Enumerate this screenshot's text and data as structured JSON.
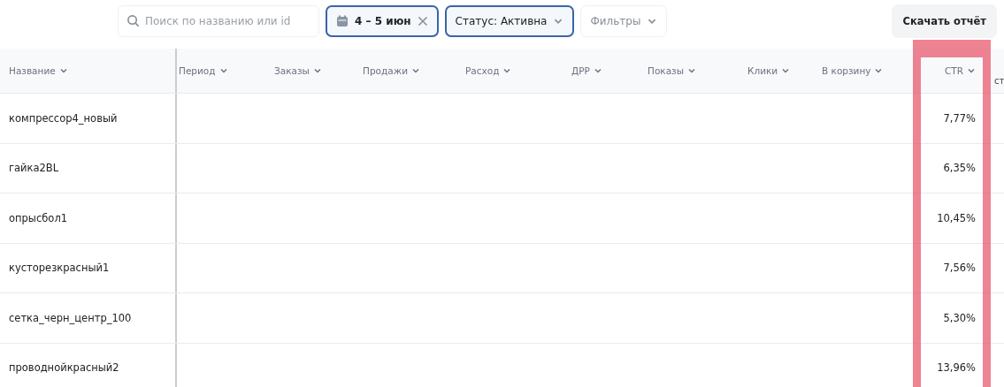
{
  "toolbar": {
    "search": {
      "placeholder": "Поиск по названию или id"
    },
    "date_filter": {
      "label": "4 – 5 июн",
      "active": true
    },
    "status_filter": {
      "label": "Статус: Активна",
      "active": true
    },
    "filters": {
      "label": "Фильтры",
      "active": false
    },
    "download_button": "Скачать отчёт"
  },
  "table": {
    "columns": [
      {
        "label": "Название"
      },
      {
        "label": "Период"
      },
      {
        "label": "Заказы"
      },
      {
        "label": "Продажи"
      },
      {
        "label": "Расход"
      },
      {
        "label": "ДРР"
      },
      {
        "label": "Показы"
      },
      {
        "label": "Клики"
      },
      {
        "label": "В корзину"
      },
      {
        "label": "CTR",
        "highlighted": true
      }
    ],
    "column_11": "ст",
    "rows": [
      {
        "name": "компрессор4_новый",
        "ctr": "7,77%"
      },
      {
        "name": "гайка2BL",
        "ctr": "6,35%"
      },
      {
        "name": "опрысбол1",
        "ctr": "10,45%"
      },
      {
        "name": "кусторезкрасный1",
        "ctr": "7,56%"
      },
      {
        "name": "сетка_черн_центр_100",
        "ctr": "5,30%"
      },
      {
        "name": "проводнойкрасный2",
        "ctr": "13,96%"
      }
    ]
  }
}
